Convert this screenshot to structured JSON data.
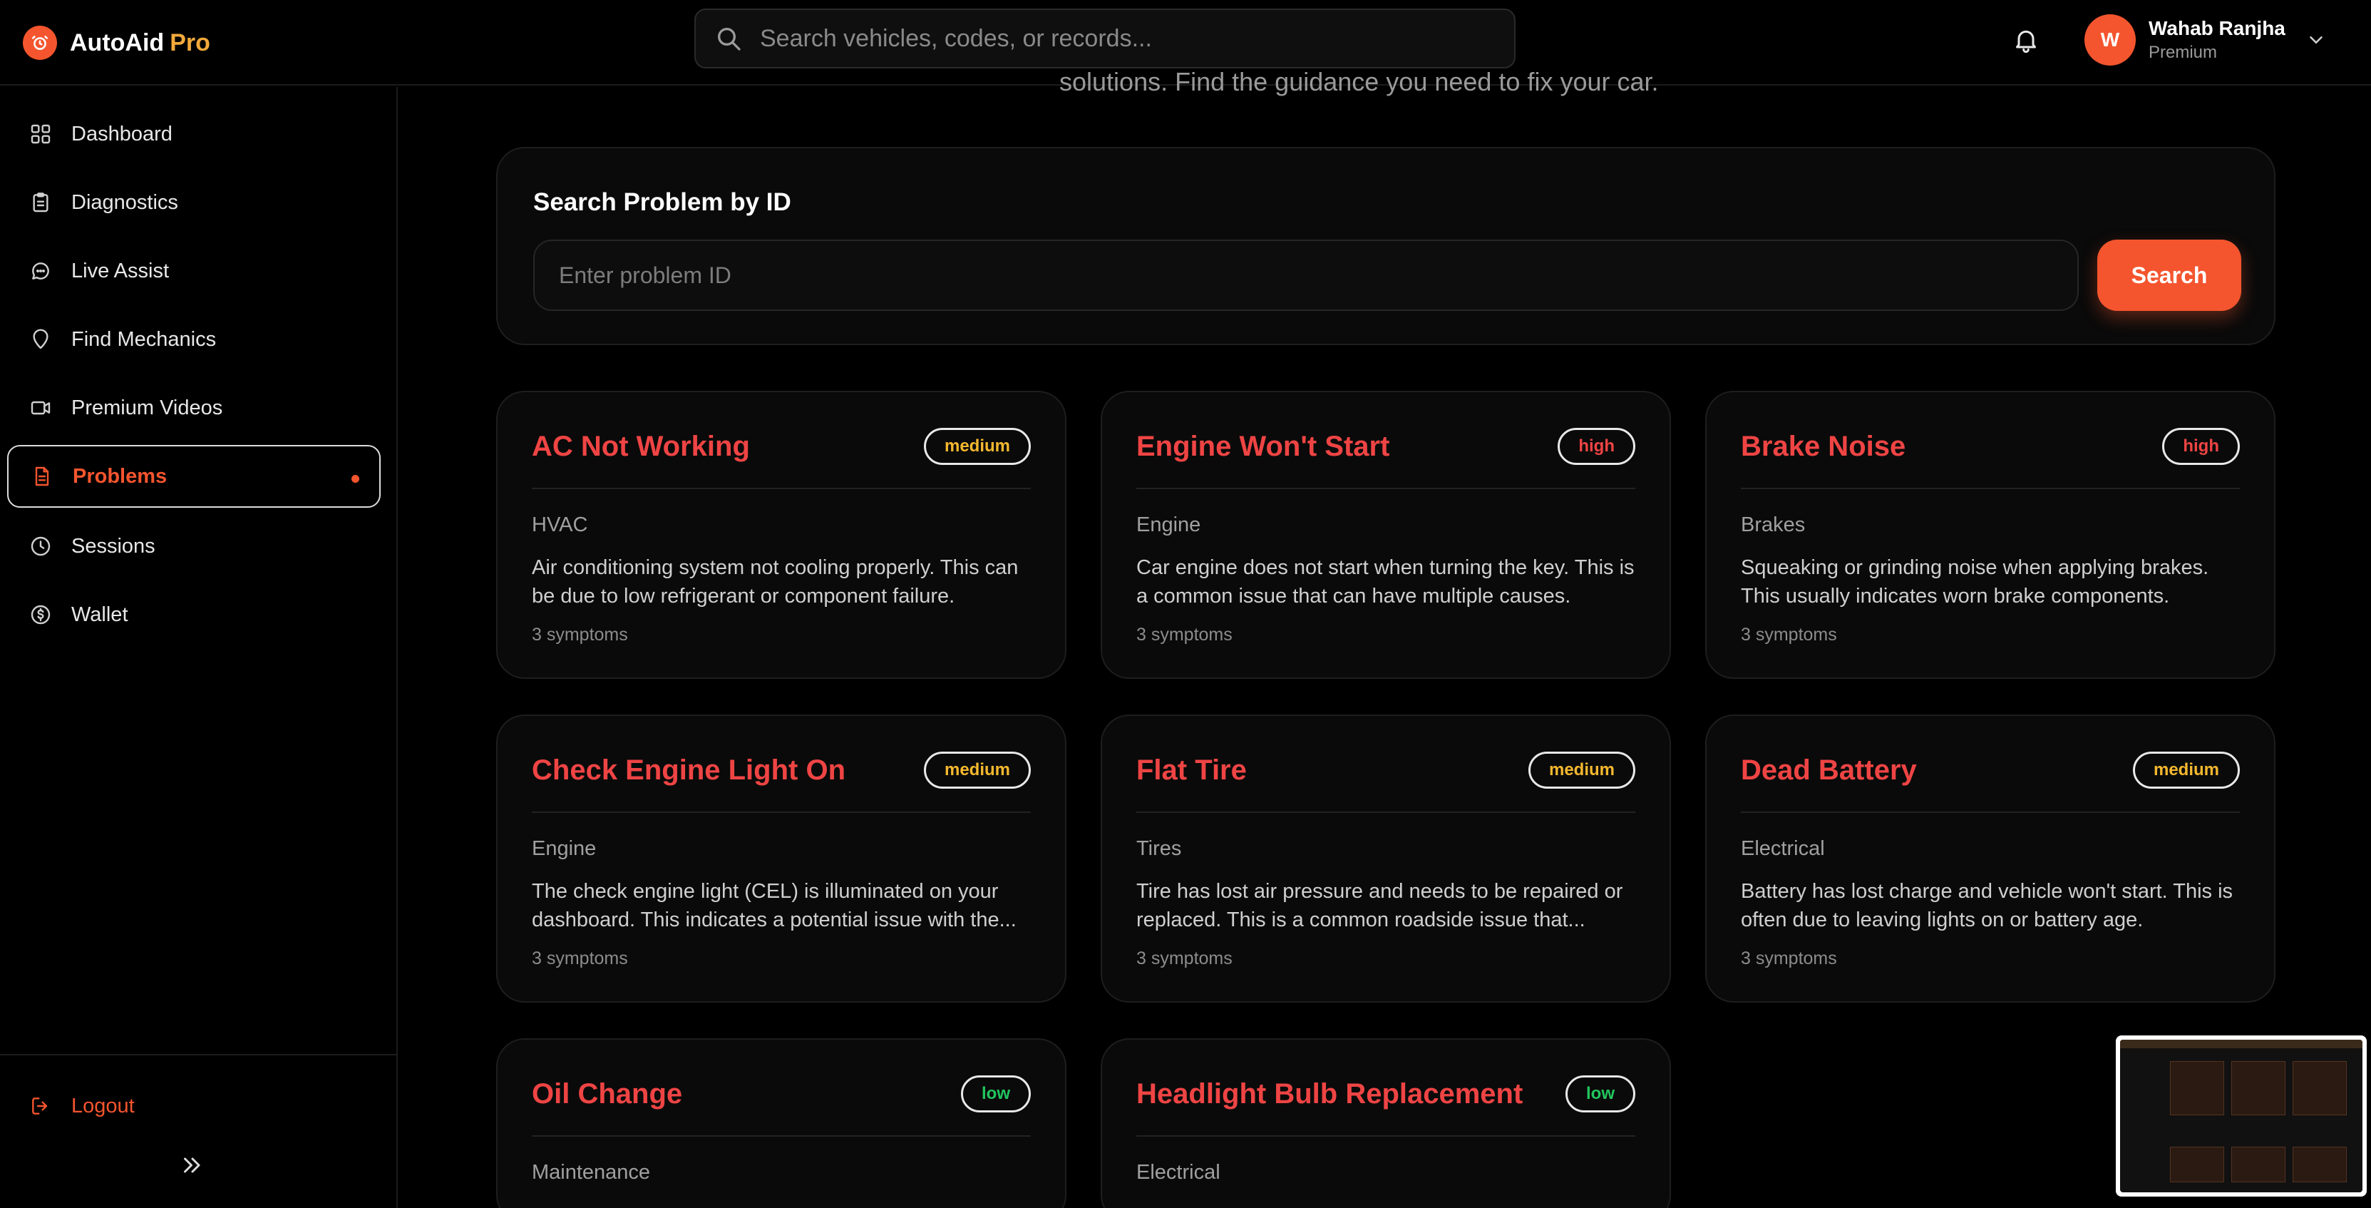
{
  "brand": {
    "name": "AutoAid",
    "accent": "Pro"
  },
  "header": {
    "search_placeholder": "Search vehicles, codes, or records...",
    "user": {
      "initial": "W",
      "name": "Wahab Ranjha",
      "plan": "Premium"
    }
  },
  "sidebar": {
    "items": [
      {
        "label": "Dashboard",
        "icon": "grid-icon"
      },
      {
        "label": "Diagnostics",
        "icon": "clipboard-icon"
      },
      {
        "label": "Live Assist",
        "icon": "chat-bubble-icon"
      },
      {
        "label": "Find Mechanics",
        "icon": "map-pin-icon"
      },
      {
        "label": "Premium Videos",
        "icon": "video-camera-icon"
      },
      {
        "label": "Problems",
        "icon": "document-icon",
        "active": true
      },
      {
        "label": "Sessions",
        "icon": "clock-icon"
      },
      {
        "label": "Wallet",
        "icon": "dollar-circle-icon"
      }
    ],
    "logout_label": "Logout"
  },
  "main": {
    "subtitle": "solutions. Find the guidance you need to fix your car.",
    "search_card": {
      "title": "Search Problem by ID",
      "placeholder": "Enter problem ID",
      "button_label": "Search"
    },
    "problems": [
      {
        "title": "AC Not Working",
        "severity": "medium",
        "category": "HVAC",
        "description": "Air conditioning system not cooling properly. This can be due to low refrigerant or component failure.",
        "symptoms": "3 symptoms"
      },
      {
        "title": "Engine Won't Start",
        "severity": "high",
        "category": "Engine",
        "description": "Car engine does not start when turning the key. This is a common issue that can have multiple causes.",
        "symptoms": "3 symptoms"
      },
      {
        "title": "Brake Noise",
        "severity": "high",
        "category": "Brakes",
        "description": "Squeaking or grinding noise when applying brakes. This usually indicates worn brake components.",
        "symptoms": "3 symptoms"
      },
      {
        "title": "Check Engine Light On",
        "severity": "medium",
        "category": "Engine",
        "description": "The check engine light (CEL) is illuminated on your dashboard. This indicates a potential issue with the...",
        "symptoms": "3 symptoms"
      },
      {
        "title": "Flat Tire",
        "severity": "medium",
        "category": "Tires",
        "description": "Tire has lost air pressure and needs to be repaired or replaced. This is a common roadside issue that...",
        "symptoms": "3 symptoms"
      },
      {
        "title": "Dead Battery",
        "severity": "medium",
        "category": "Electrical",
        "description": "Battery has lost charge and vehicle won't start. This is often due to leaving lights on or battery age.",
        "symptoms": "3 symptoms"
      },
      {
        "title": "Oil Change",
        "severity": "low",
        "category": "Maintenance",
        "description": "",
        "symptoms": ""
      },
      {
        "title": "Headlight Bulb Replacement",
        "severity": "low",
        "category": "Electrical",
        "description": "",
        "symptoms": ""
      }
    ]
  },
  "colors": {
    "accent": "#f4552e",
    "title_red": "#ef4444",
    "medium": "#f5b82e",
    "high": "#ef4444",
    "low": "#22c55e",
    "brand_accent": "#f2a93b"
  }
}
